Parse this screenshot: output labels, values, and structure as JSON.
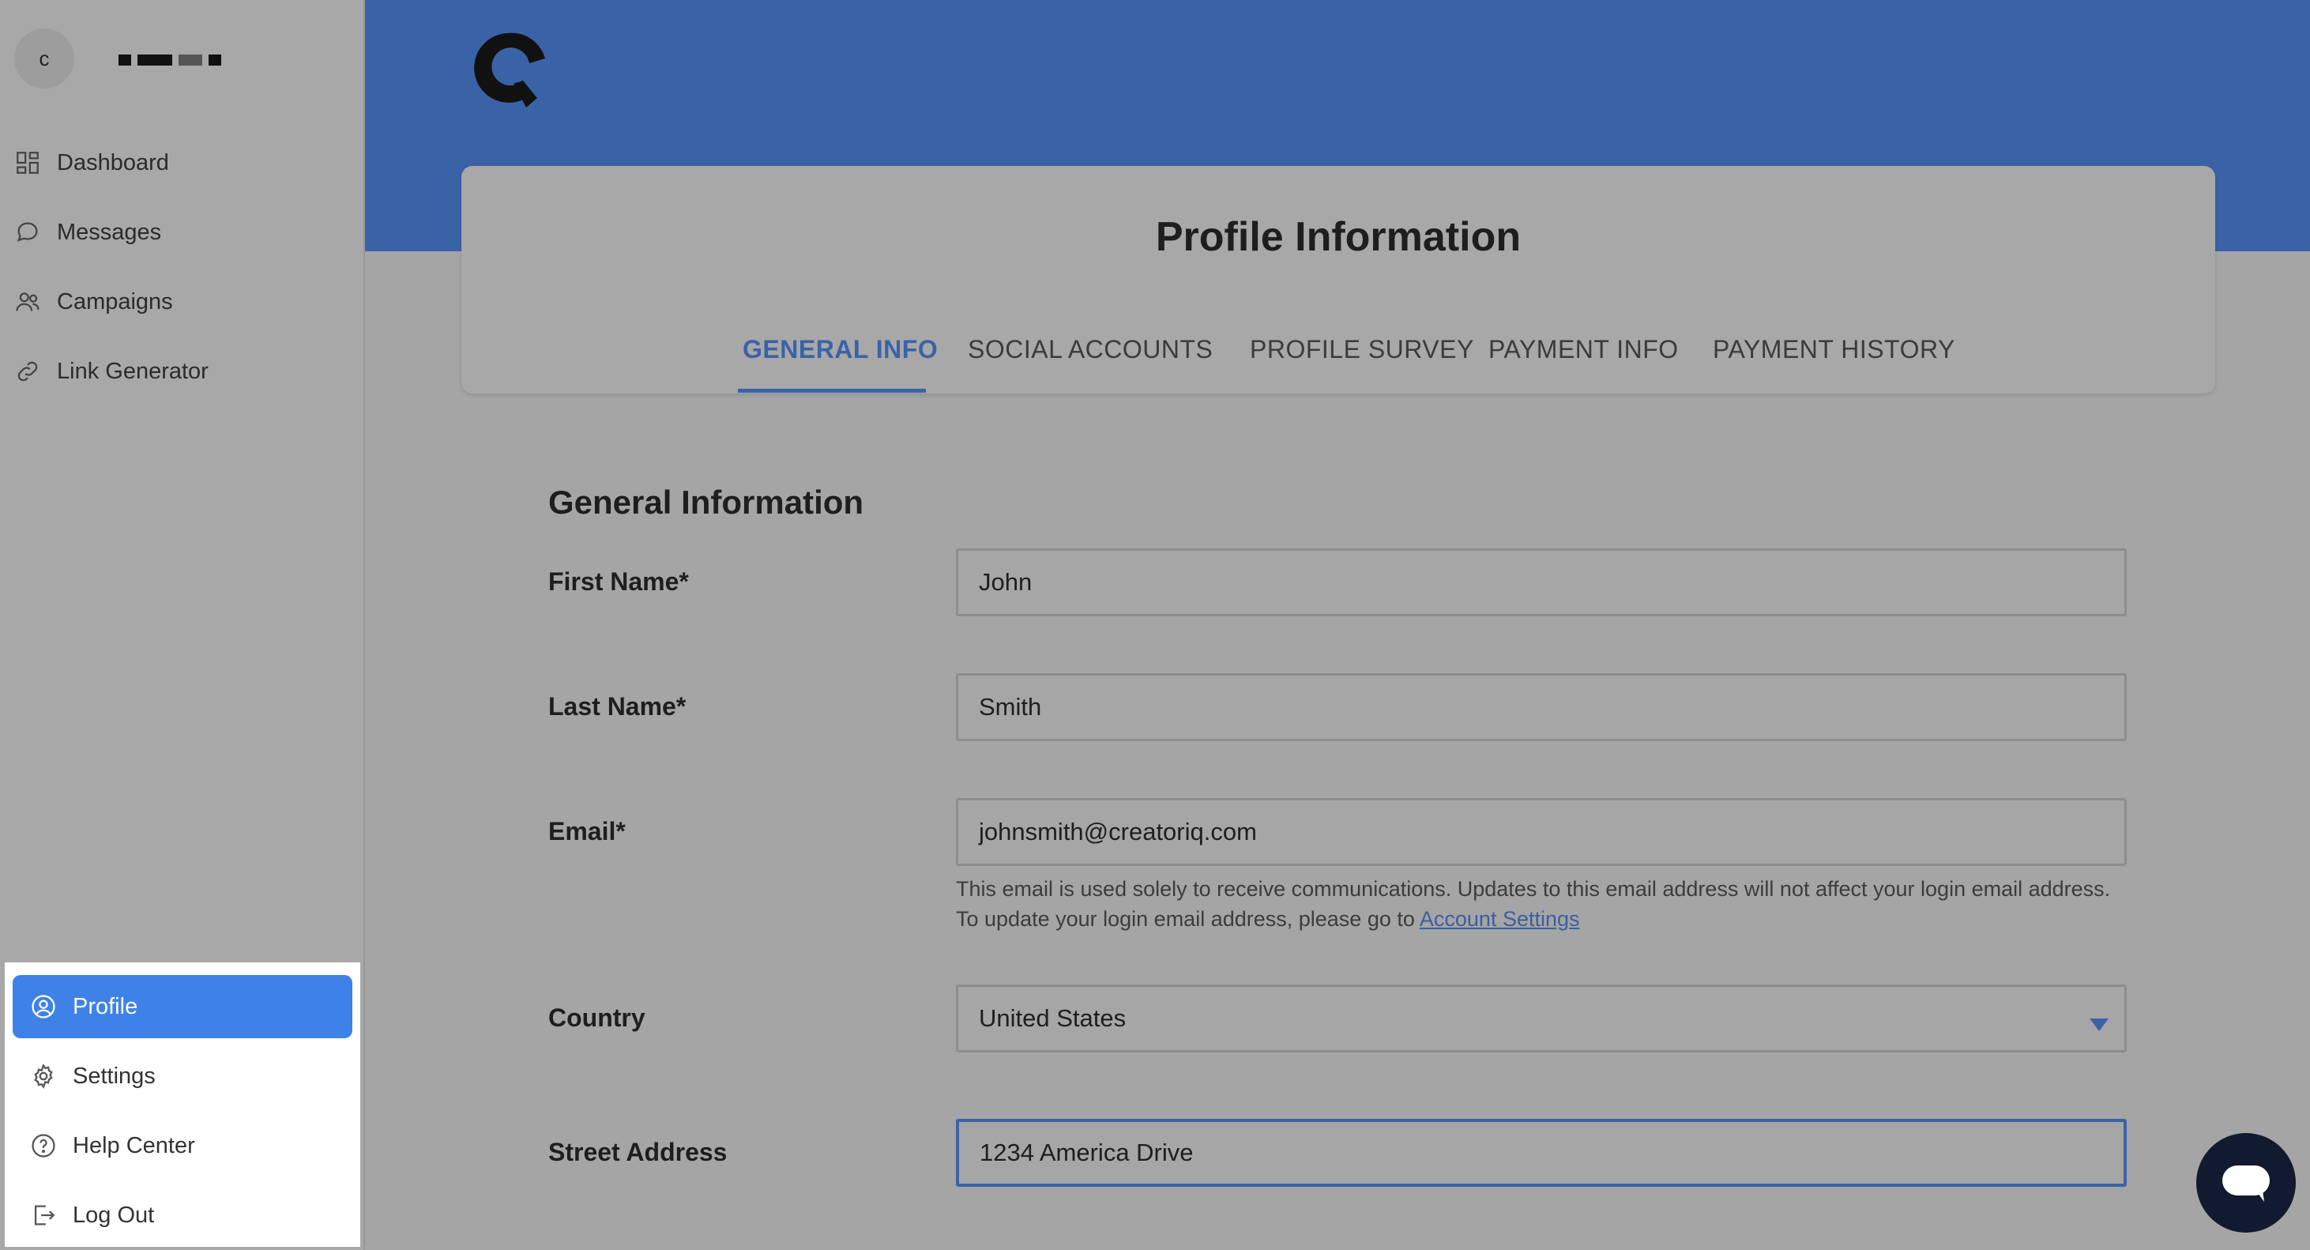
{
  "sidebar": {
    "avatar_initial": "c",
    "nav": [
      {
        "label": "Dashboard",
        "icon": "dashboard-icon"
      },
      {
        "label": "Messages",
        "icon": "chat-bubble-icon"
      },
      {
        "label": "Campaigns",
        "icon": "users-icon"
      },
      {
        "label": "Link Generator",
        "icon": "link-icon"
      }
    ],
    "menu": [
      {
        "label": "Profile",
        "icon": "user-circle-icon",
        "active": true
      },
      {
        "label": "Settings",
        "icon": "gear-icon"
      },
      {
        "label": "Help Center",
        "icon": "help-circle-icon"
      },
      {
        "label": "Log Out",
        "icon": "logout-icon"
      }
    ]
  },
  "header": {
    "title": "Profile Information",
    "tabs": [
      "GENERAL INFO",
      "SOCIAL ACCOUNTS",
      "PROFILE SURVEY",
      "PAYMENT INFO",
      "PAYMENT HISTORY"
    ],
    "active_tab": "GENERAL INFO"
  },
  "form": {
    "section_title": "General Information",
    "first_name": {
      "label": "First Name*",
      "value": "John"
    },
    "last_name": {
      "label": "Last Name*",
      "value": "Smith"
    },
    "email": {
      "label": "Email*",
      "value": "johnsmith@creatoriq.com",
      "help": "This email is used solely to receive communications. Updates to this email address will not affect your login email address. To update your login email address, please go to",
      "help_link": "Account Settings"
    },
    "country": {
      "label": "Country",
      "value": "United States"
    },
    "street": {
      "label": "Street Address",
      "value": "1234 America Drive"
    }
  },
  "colors": {
    "brand_blue": "#3a63a7",
    "active_menu": "#3e82e8",
    "chat_button": "#111a2e"
  }
}
